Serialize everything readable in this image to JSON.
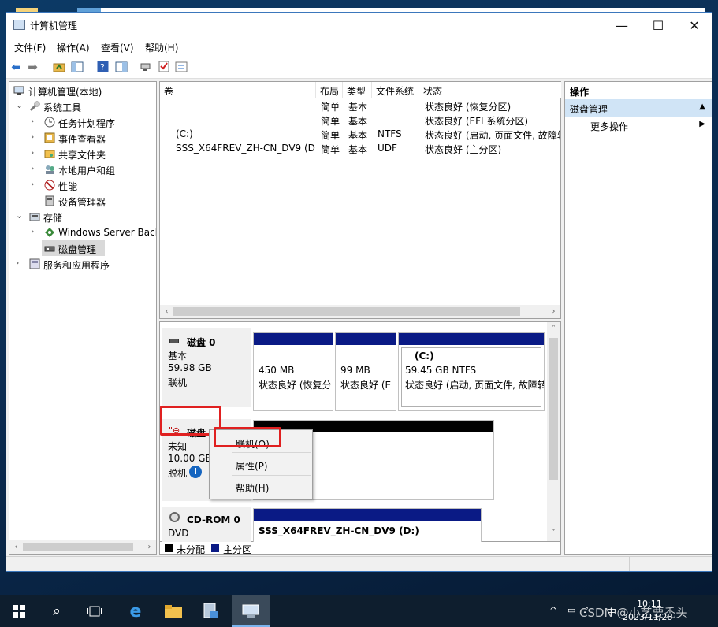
{
  "window": {
    "title": "计算机管理",
    "minimize_glyph": "—",
    "maximize_glyph": "☐",
    "close_glyph": "✕"
  },
  "menu": [
    "文件(F)",
    "操作(A)",
    "查看(V)",
    "帮助(H)"
  ],
  "tree": {
    "root": "计算机管理(本地)",
    "items": [
      {
        "label": "系统工具",
        "indent": 1,
        "expanded": true,
        "icon": "tools-icon"
      },
      {
        "label": "任务计划程序",
        "indent": 2,
        "expanded": false,
        "icon": "clock-icon"
      },
      {
        "label": "事件查看器",
        "indent": 2,
        "expanded": false,
        "icon": "event-viewer-icon"
      },
      {
        "label": "共享文件夹",
        "indent": 2,
        "expanded": false,
        "icon": "shared-folder-icon"
      },
      {
        "label": "本地用户和组",
        "indent": 2,
        "expanded": false,
        "icon": "users-icon"
      },
      {
        "label": "性能",
        "indent": 2,
        "expanded": false,
        "icon": "performance-icon"
      },
      {
        "label": "设备管理器",
        "indent": 2,
        "expanded": null,
        "icon": "device-manager-icon"
      },
      {
        "label": "存储",
        "indent": 1,
        "expanded": true,
        "icon": "storage-icon"
      },
      {
        "label": "Windows Server Back",
        "indent": 2,
        "expanded": false,
        "icon": "backup-icon"
      },
      {
        "label": "磁盘管理",
        "indent": 2,
        "expanded": null,
        "icon": "disk-management-icon",
        "selected": true
      },
      {
        "label": "服务和应用程序",
        "indent": 1,
        "expanded": false,
        "icon": "services-icon"
      }
    ]
  },
  "volume_table": {
    "columns": [
      "卷",
      "布局",
      "类型",
      "文件系统",
      "状态"
    ],
    "rows": [
      {
        "vol": "",
        "layout": "简单",
        "type": "基本",
        "fs": "",
        "status": "状态良好 (恢复分区)"
      },
      {
        "vol": "",
        "layout": "简单",
        "type": "基本",
        "fs": "",
        "status": "状态良好 (EFI 系统分区)"
      },
      {
        "vol": "(C:)",
        "layout": "简单",
        "type": "基本",
        "fs": "NTFS",
        "status": "状态良好 (启动, 页面文件, 故障转"
      },
      {
        "vol": "SSS_X64FREV_ZH-CN_DV9 (D:)",
        "layout": "简单",
        "type": "基本",
        "fs": "UDF",
        "status": "状态良好 (主分区)"
      }
    ]
  },
  "disks": {
    "disk0": {
      "name": "磁盘 0",
      "type": "基本",
      "size": "59.98 GB",
      "status": "联机",
      "partitions": [
        {
          "title": "",
          "size": "450 MB",
          "status": "状态良好 (恢复分"
        },
        {
          "title": "",
          "size": "99 MB",
          "status": "状态良好 (E"
        },
        {
          "title": "(C:)",
          "size": "59.45 GB NTFS",
          "status": "状态良好 (启动, 页面文件, 故障转"
        }
      ]
    },
    "disk1": {
      "name": "磁盘 1",
      "type": "未知",
      "size": "10.00 GB",
      "status": "脱机"
    },
    "cdrom": {
      "name": "CD-ROM 0",
      "type": "DVD",
      "volume": "SSS_X64FREV_ZH-CN_DV9  (D:)"
    }
  },
  "legend": [
    "未分配",
    "主分区"
  ],
  "context_menu": [
    "联机(O)",
    "属性(P)",
    "帮助(H)"
  ],
  "actions": {
    "header": "操作",
    "selected": "磁盘管理",
    "more": "更多操作"
  },
  "taskbar": {
    "ime": "中",
    "time": "10:11",
    "date": "2023/11/28",
    "watermark": "CSDN @小艺要秃头"
  },
  "colors": {
    "primary_partition": "#0a1a85",
    "unallocated": "#000000",
    "highlight_red": "#e02020",
    "selection": "#d0e4f6"
  }
}
